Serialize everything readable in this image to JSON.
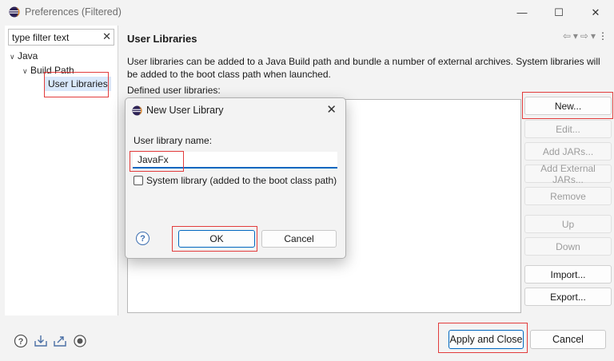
{
  "window": {
    "title": "Preferences (Filtered)",
    "controls": {
      "minimize": "—",
      "maximize": "☐",
      "close": "✕"
    }
  },
  "sidebar": {
    "filter_placeholder": "type filter text",
    "clear_glyph": "✕",
    "tree": [
      {
        "label": "Java",
        "expanded": true,
        "level": 0
      },
      {
        "label": "Build Path",
        "expanded": true,
        "level": 1
      },
      {
        "label": "User Libraries",
        "selected": true,
        "level": 2
      }
    ]
  },
  "main": {
    "title": "User Libraries",
    "nav": {
      "back": "⇦",
      "back_menu": "▾",
      "forward": "⇨",
      "forward_menu": "▾",
      "more": "⋮"
    },
    "description": "User libraries can be added to a Java Build path and bundle a number of external archives. System libraries will be added to the boot class path when launched.",
    "defined_label": "Defined user libraries:",
    "buttons": {
      "new": "New...",
      "edit": "Edit...",
      "add_jars": "Add JARs...",
      "add_external_jars": "Add External JARs...",
      "remove": "Remove",
      "up": "Up",
      "down": "Down",
      "import": "Import...",
      "export": "Export..."
    }
  },
  "footer": {
    "apply_close": "Apply and Close",
    "cancel": "Cancel",
    "icons": [
      "help-icon",
      "import-icon",
      "export-icon",
      "record-icon"
    ]
  },
  "dialog": {
    "title": "New User Library",
    "close_glyph": "✕",
    "name_label": "User library name:",
    "name_value": "JavaFx",
    "system_library_label": "System library (added to the boot class path)",
    "system_library_checked": false,
    "ok": "OK",
    "cancel": "Cancel",
    "help_glyph": "?"
  },
  "colors": {
    "accent": "#0067c0",
    "highlight": "#e23c3c",
    "eclipse_purple": "#2c2255",
    "eclipse_orange": "#f7941e"
  }
}
